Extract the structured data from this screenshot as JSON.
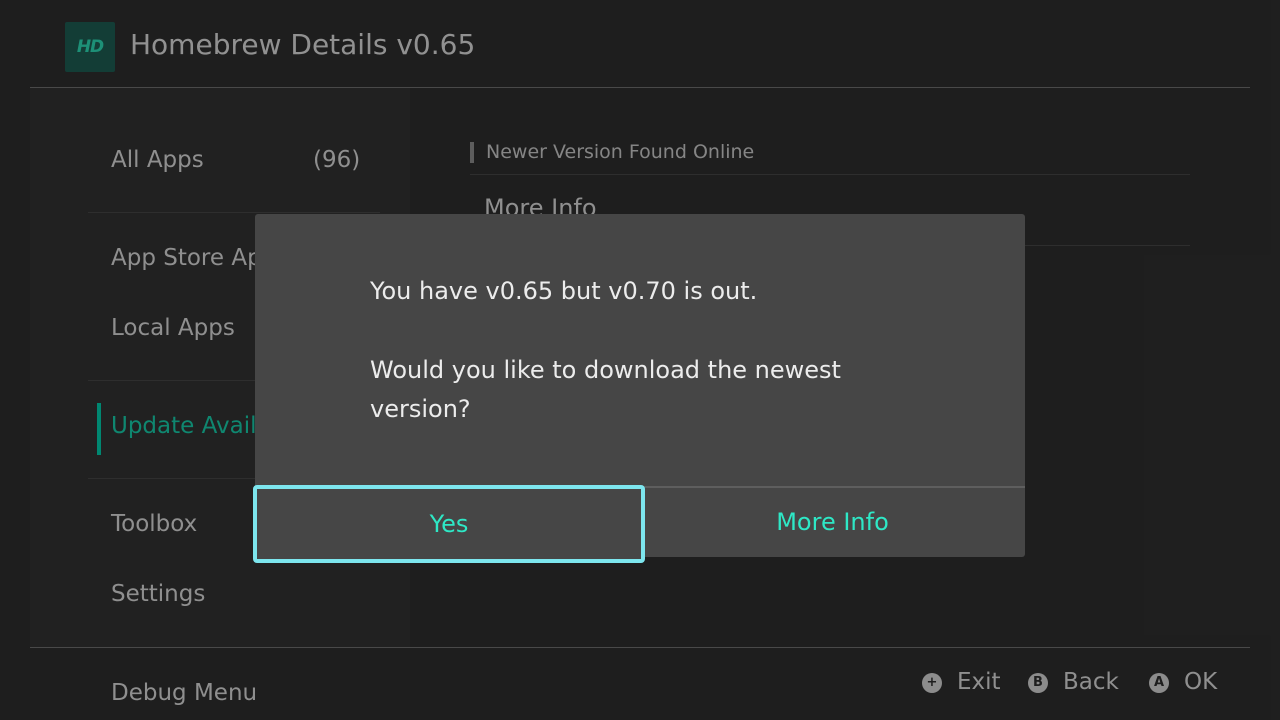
{
  "header": {
    "logo_text": "HD",
    "title": "Homebrew Details v0.65"
  },
  "sidebar": {
    "items": [
      {
        "label": "All Apps",
        "count": "(96)"
      },
      {
        "label": "App Store Ap"
      },
      {
        "label": "Local Apps"
      },
      {
        "label": "Update Avail",
        "selected": true
      },
      {
        "label": "Toolbox"
      },
      {
        "label": "Settings"
      }
    ]
  },
  "content": {
    "heading": "Newer Version Found Online",
    "item_label": "More Info"
  },
  "footer": {
    "debug_menu": "Debug Menu",
    "hints": [
      {
        "icon": "plus-button-icon",
        "glyph": "+",
        "label": "Exit"
      },
      {
        "icon": "b-button-icon",
        "glyph": "B",
        "label": "Back"
      },
      {
        "icon": "a-button-icon",
        "glyph": "A",
        "label": "OK"
      }
    ]
  },
  "dialog": {
    "line1": "You have v0.65 but v0.70 is out.",
    "line2": "Would you like to download the newest",
    "line3": "version?",
    "yes_label": "Yes",
    "more_info_label": "More Info"
  },
  "colors": {
    "background": "#2d2d2d",
    "accent": "#17c8a6",
    "dialog_button_text": "#2ee8c6",
    "focus_border": "#7de6ee",
    "dialog_bg": "#464646"
  }
}
